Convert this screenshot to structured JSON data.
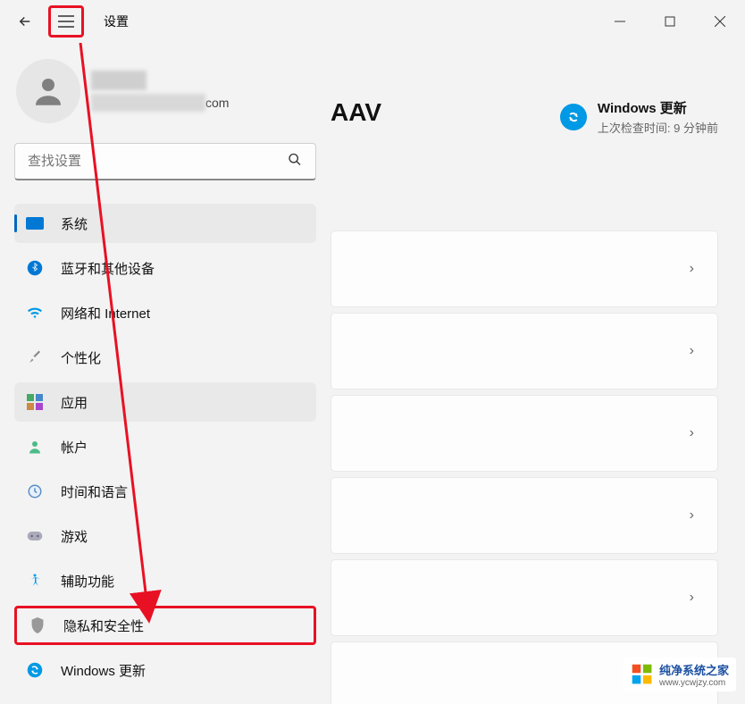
{
  "app": {
    "title": "设置"
  },
  "search": {
    "placeholder": "查找设置"
  },
  "user": {
    "email_suffix": "com"
  },
  "partial_heading": "AAV",
  "update_tile": {
    "title": "Windows 更新",
    "subtitle": "上次检查时间: 9 分钟前"
  },
  "sidebar": {
    "items": [
      {
        "label": "系统",
        "icon": "monitor"
      },
      {
        "label": "蓝牙和其他设备",
        "icon": "bluetooth"
      },
      {
        "label": "网络和 Internet",
        "icon": "wifi"
      },
      {
        "label": "个性化",
        "icon": "brush"
      },
      {
        "label": "应用",
        "icon": "apps"
      },
      {
        "label": "帐户",
        "icon": "person"
      },
      {
        "label": "时间和语言",
        "icon": "clock"
      },
      {
        "label": "游戏",
        "icon": "gamepad"
      },
      {
        "label": "辅助功能",
        "icon": "accessibility"
      },
      {
        "label": "隐私和安全性",
        "icon": "shield"
      },
      {
        "label": "Windows 更新",
        "icon": "sync"
      }
    ]
  },
  "watermark": {
    "line1": "纯净系统之家",
    "line2": "www.ycwjzy.com"
  },
  "colors": {
    "accent": "#0067c0",
    "highlight": "#e81123"
  }
}
